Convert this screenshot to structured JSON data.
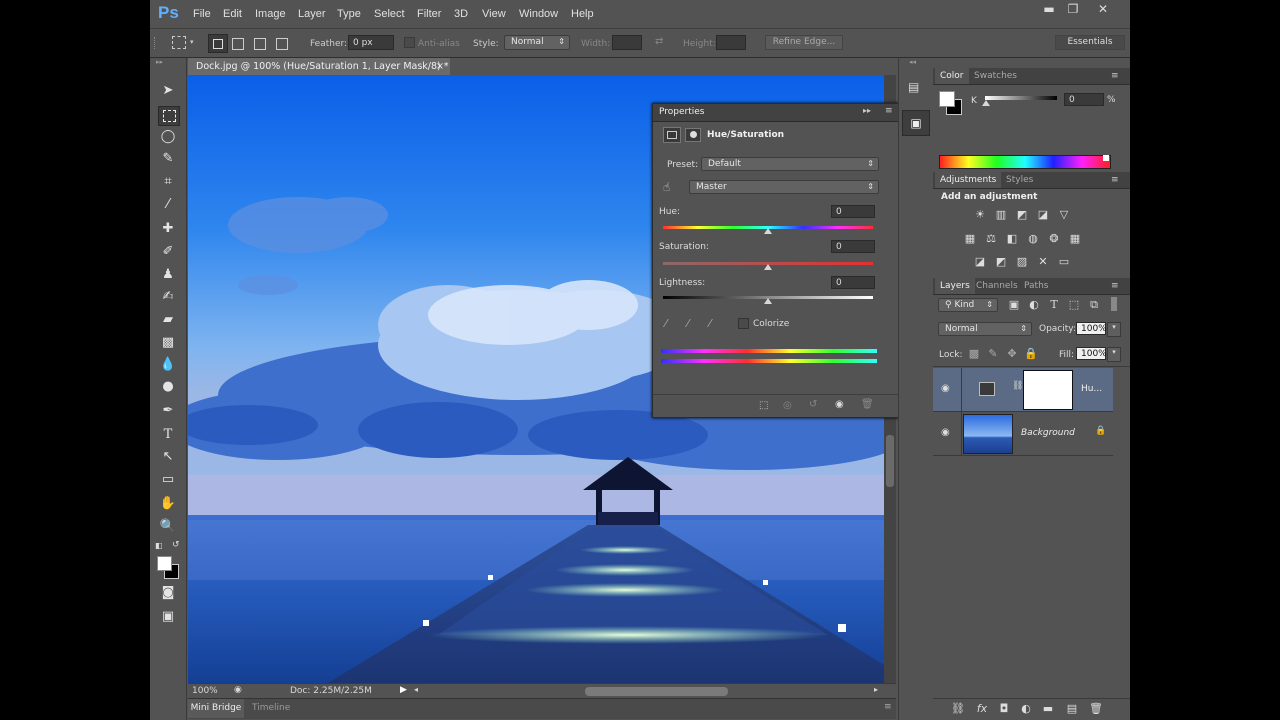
{
  "app": {
    "logo": "Ps"
  },
  "menu": [
    "File",
    "Edit",
    "Image",
    "Layer",
    "Type",
    "Select",
    "Filter",
    "3D",
    "View",
    "Window",
    "Help"
  ],
  "window_controls": {
    "minimize": "▬",
    "restore": "❐",
    "close": "✕"
  },
  "options_bar": {
    "feather_label": "Feather:",
    "feather_value": "0 px",
    "antialias_label": "Anti-alias",
    "style_label": "Style:",
    "style_value": "Normal",
    "width_label": "Width:",
    "height_label": "Height:",
    "refine_edge": "Refine Edge...",
    "workspace": "Essentials"
  },
  "document": {
    "tab_title": "Dock.jpg @ 100% (Hue/Saturation 1, Layer Mask/8) *",
    "zoom": "100%",
    "doc_size": "Doc: 2.25M/2.25M",
    "bottom_tabs": [
      "Mini Bridge",
      "Timeline"
    ]
  },
  "properties": {
    "panel_title": "Properties",
    "adjustment_name": "Hue/Saturation",
    "preset_label": "Preset:",
    "preset_value": "Default",
    "channel_value": "Master",
    "hue_label": "Hue:",
    "hue_value": "0",
    "saturation_label": "Saturation:",
    "saturation_value": "0",
    "lightness_label": "Lightness:",
    "lightness_value": "0",
    "colorize_label": "Colorize"
  },
  "color_panel": {
    "tabs": [
      "Color",
      "Swatches"
    ],
    "channel_label": "K",
    "channel_value": "0",
    "unit": "%"
  },
  "adjustments_panel": {
    "tabs": [
      "Adjustments",
      "Styles"
    ],
    "heading": "Add an adjustment"
  },
  "layers_panel": {
    "tabs": [
      "Layers",
      "Channels",
      "Paths"
    ],
    "filter_kind": "Kind",
    "blend_mode": "Normal",
    "opacity_label": "Opacity:",
    "opacity_value": "100%",
    "lock_label": "Lock:",
    "fill_label": "Fill:",
    "fill_value": "100%",
    "layers": [
      {
        "name": "Hu...",
        "type": "adjustment"
      },
      {
        "name": "Background",
        "type": "image"
      }
    ]
  },
  "colors": {
    "ui_bg": "#535353",
    "panel_dark": "#424242",
    "ps_blue": "#5fb0ff"
  }
}
